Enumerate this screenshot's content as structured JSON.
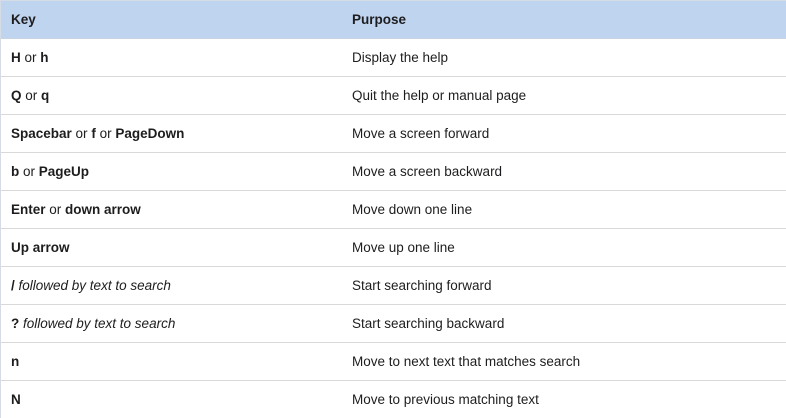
{
  "table": {
    "header": {
      "key": "Key",
      "purpose": "Purpose"
    },
    "rows": [
      {
        "key": [
          {
            "t": "H",
            "s": "b"
          },
          {
            "t": " or ",
            "s": ""
          },
          {
            "t": "h",
            "s": "b"
          }
        ],
        "purpose": "Display the help"
      },
      {
        "key": [
          {
            "t": "Q",
            "s": "b"
          },
          {
            "t": " or ",
            "s": ""
          },
          {
            "t": "q",
            "s": "b"
          }
        ],
        "purpose": "Quit the help or manual page"
      },
      {
        "key": [
          {
            "t": "Spacebar",
            "s": "b"
          },
          {
            "t": " or ",
            "s": ""
          },
          {
            "t": "f",
            "s": "b"
          },
          {
            "t": " or ",
            "s": ""
          },
          {
            "t": "PageDown",
            "s": "b"
          }
        ],
        "purpose": "Move a screen forward"
      },
      {
        "key": [
          {
            "t": "b",
            "s": "b"
          },
          {
            "t": " or ",
            "s": ""
          },
          {
            "t": "PageUp",
            "s": "b"
          }
        ],
        "purpose": "Move a screen backward"
      },
      {
        "key": [
          {
            "t": "Enter",
            "s": "b"
          },
          {
            "t": " or ",
            "s": ""
          },
          {
            "t": "down arrow",
            "s": "b"
          }
        ],
        "purpose": "Move down one line"
      },
      {
        "key": [
          {
            "t": "Up arrow",
            "s": "b"
          }
        ],
        "purpose": "Move up one line"
      },
      {
        "key": [
          {
            "t": "/",
            "s": "b"
          },
          {
            "t": " followed by text to search",
            "s": "i"
          }
        ],
        "purpose": "Start searching forward"
      },
      {
        "key": [
          {
            "t": "?",
            "s": "b"
          },
          {
            "t": " followed by text to search",
            "s": "i"
          }
        ],
        "purpose": "Start searching backward"
      },
      {
        "key": [
          {
            "t": "n",
            "s": "b"
          }
        ],
        "purpose": "Move to next text that matches search"
      },
      {
        "key": [
          {
            "t": "N",
            "s": "b"
          }
        ],
        "purpose": "Move to previous matching text"
      }
    ]
  }
}
